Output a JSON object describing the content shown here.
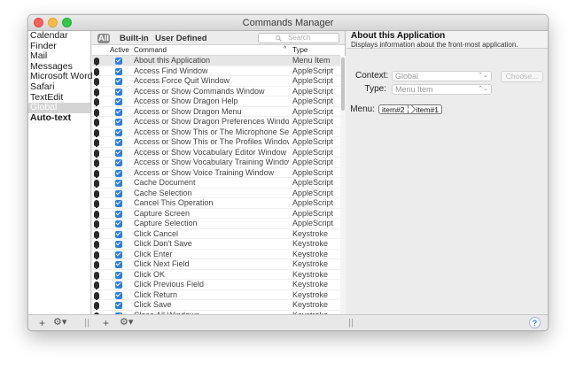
{
  "window": {
    "title": "Commands Manager"
  },
  "sidebar": {
    "items": [
      {
        "label": "Calendar"
      },
      {
        "label": "Finder"
      },
      {
        "label": "Mail"
      },
      {
        "label": "Messages"
      },
      {
        "label": "Microsoft Word"
      },
      {
        "label": "Safari"
      },
      {
        "label": "TextEdit"
      },
      {
        "label": "Global"
      },
      {
        "label": "Auto-text"
      }
    ],
    "selected_index": 7
  },
  "filters": {
    "all": "All",
    "builtin": "Built-in",
    "user_defined": "User Defined"
  },
  "search": {
    "placeholder": "Search"
  },
  "columns": {
    "active": "Active",
    "command": "Command",
    "sort": "^",
    "type": "Type"
  },
  "commands": [
    {
      "name": "About this Application",
      "type": "Menu Item"
    },
    {
      "name": "Access Find Window",
      "type": "AppleScript"
    },
    {
      "name": "Access Force Quit Window",
      "type": "AppleScript"
    },
    {
      "name": "Access or Show Commands Window",
      "type": "AppleScript"
    },
    {
      "name": "Access or Show Dragon Help",
      "type": "AppleScript"
    },
    {
      "name": "Access or Show Dragon Menu",
      "type": "AppleScript"
    },
    {
      "name": "Access or Show Dragon Preferences Window",
      "type": "AppleScript"
    },
    {
      "name": "Access or Show This or The Microphone Setup...",
      "type": "AppleScript"
    },
    {
      "name": "Access or Show This or The Profiles Window",
      "type": "AppleScript"
    },
    {
      "name": "Access or Show Vocabulary Editor Window",
      "type": "AppleScript"
    },
    {
      "name": "Access or Show Vocabulary Training Window",
      "type": "AppleScript"
    },
    {
      "name": "Access or Show Voice Training Window",
      "type": "AppleScript"
    },
    {
      "name": "Cache Document",
      "type": "AppleScript"
    },
    {
      "name": "Cache Selection",
      "type": "AppleScript"
    },
    {
      "name": "Cancel This Operation",
      "type": "AppleScript"
    },
    {
      "name": "Capture Screen",
      "type": "AppleScript"
    },
    {
      "name": "Capture Selection",
      "type": "AppleScript"
    },
    {
      "name": "Click Cancel",
      "type": "Keystroke"
    },
    {
      "name": "Click Don't Save",
      "type": "Keystroke"
    },
    {
      "name": "Click Enter",
      "type": "Keystroke"
    },
    {
      "name": "Click Next Field",
      "type": "Keystroke"
    },
    {
      "name": "Click OK",
      "type": "Keystroke"
    },
    {
      "name": "Click Previous Field",
      "type": "Keystroke"
    },
    {
      "name": "Click Return",
      "type": "Keystroke"
    },
    {
      "name": "Click Save",
      "type": "Keystroke"
    },
    {
      "name": "Close All Windows",
      "type": "Keystroke"
    }
  ],
  "detail": {
    "title": "About this Application",
    "description": "Displays information about the front-most application.",
    "context_label": "Context:",
    "context_value": "Global",
    "type_label": "Type:",
    "type_value": "Menu Item",
    "choose_label": "Choose...",
    "menu_label": "Menu:",
    "menu_path": [
      "item#2",
      "item#1"
    ]
  },
  "footer": {
    "add": "+",
    "gear": "⚙▾",
    "help": "?"
  }
}
